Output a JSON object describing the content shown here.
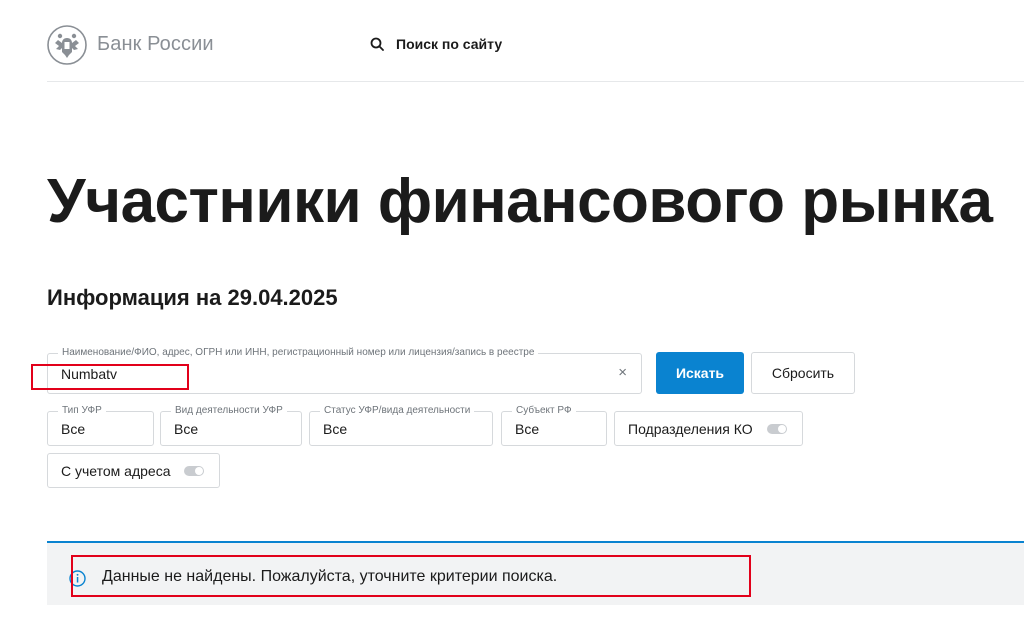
{
  "header": {
    "brand": "Банк России",
    "logo_icon": "double-headed-eagle-icon",
    "search_label": "Поиск по сайту",
    "search_icon": "search-icon"
  },
  "page": {
    "title": "Участники финансового рынка",
    "info": "Информация на 29.04.2025"
  },
  "search": {
    "label": "Наименование/ФИО, адрес, ОГРН или ИНН, регистрационный номер или лицензия/запись в реестре",
    "value": "Numbatv",
    "clear": "×",
    "submit_label": "Искать",
    "reset_label": "Сбросить"
  },
  "filters": [
    {
      "label": "Тип УФР",
      "value": "Все"
    },
    {
      "label": "Вид деятельности УФР",
      "value": "Все"
    },
    {
      "label": "Статус УФР/вида деятельности",
      "value": "Все"
    },
    {
      "label": "Субъект РФ",
      "value": "Все"
    }
  ],
  "toggles": [
    {
      "label": "Подразделения КО",
      "checked": false
    },
    {
      "label": "С учетом адреса",
      "checked": false
    }
  ],
  "message": {
    "icon": "info-icon",
    "text": "Данные не найдены. Пожалуйста, уточните критерии поиска."
  },
  "colors": {
    "accent": "#0a83d0",
    "annotation": "#e2001a",
    "brand_gray": "#8a8f95"
  }
}
